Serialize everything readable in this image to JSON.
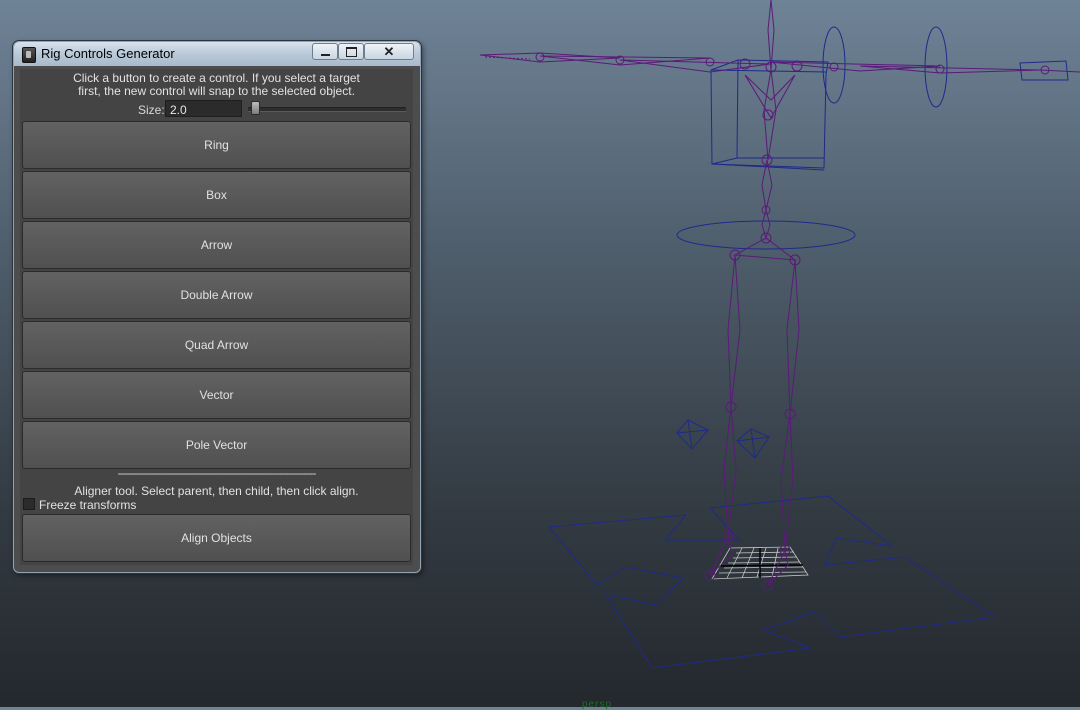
{
  "window": {
    "title": "Rig Controls Generator",
    "minimize_symbol": "▭",
    "maximize_symbol": "□",
    "close_symbol": "✕"
  },
  "instructions": {
    "line1": "Click a button to create a control. If you select a target",
    "line2": "first, the new control will snap to the selected object."
  },
  "size": {
    "label": "Size:",
    "value": "2.0"
  },
  "buttons": [
    {
      "label": "Ring"
    },
    {
      "label": "Box"
    },
    {
      "label": "Arrow"
    },
    {
      "label": "Double Arrow"
    },
    {
      "label": "Quad Arrow"
    },
    {
      "label": "Vector"
    },
    {
      "label": "Pole Vector"
    }
  ],
  "aligner": {
    "separator": "------------------------------------------------------------------",
    "description": "Aligner tool. Select parent, then child, then click align.",
    "freeze_label": "Freeze transforms",
    "freeze_checked": false,
    "align_button": "Align Objects"
  },
  "viewport": {
    "status_text": "persp"
  },
  "colors": {
    "wire_blue": "#1e2a8a",
    "joint_purple": "#5a1b78",
    "panel_bg": "#444444",
    "button_bg": "#5a5a5a"
  }
}
